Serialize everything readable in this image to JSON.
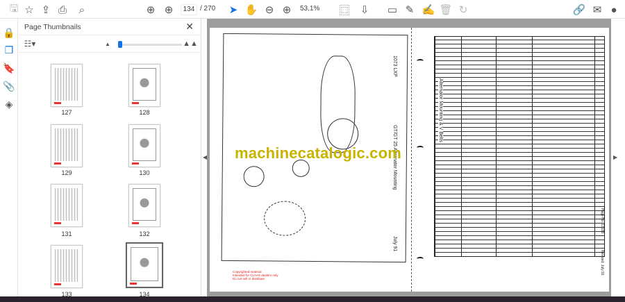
{
  "toolbar": {
    "page_current": "134",
    "page_total": "/ 270",
    "zoom": "53,1%"
  },
  "panel": {
    "title": "Page Thumbnails",
    "close": "✕"
  },
  "thumbnails": [
    {
      "label": "127"
    },
    {
      "label": "128"
    },
    {
      "label": "129"
    },
    {
      "label": "130"
    },
    {
      "label": "131"
    },
    {
      "label": "132"
    },
    {
      "label": "133"
    },
    {
      "label": "134"
    }
  ],
  "document": {
    "watermark": "machinecatalogic.com",
    "drawing_title": "GT/GT 25 Alternator Mounting",
    "date": "July 91",
    "ref": "1073 LXP",
    "table_title": "Alternator Mounting & V Belts",
    "page_no": "Page No. 13133",
    "revised": "Revised: July 91",
    "copyright": [
      "Copyrighted material",
      "Intended for CLAAS dealers only",
      "Do not sell or distribute"
    ]
  }
}
